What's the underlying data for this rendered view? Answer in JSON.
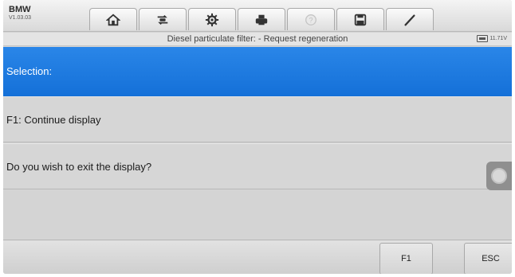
{
  "header": {
    "brand": "BMW",
    "version": "V1.03.03"
  },
  "toolbar": {
    "buttons": [
      {
        "name": "home-icon",
        "label": ""
      },
      {
        "name": "vehicle-swap-icon",
        "label": ""
      },
      {
        "name": "settings-gear-icon",
        "label": ""
      },
      {
        "name": "printer-icon",
        "label": ""
      },
      {
        "name": "help-icon",
        "label": ""
      },
      {
        "name": "save-icon",
        "label": ""
      },
      {
        "name": "edit-pen-icon",
        "label": ""
      }
    ]
  },
  "titlebar": {
    "title": "Diesel particulate filter: - Request regeneration",
    "voltage": "11.71V"
  },
  "content": {
    "selection_label": "Selection:",
    "rows": [
      {
        "label": "F1: Continue display"
      },
      {
        "label": "Do you wish to exit the display?"
      }
    ]
  },
  "footer": {
    "f1_label": "F1",
    "esc_label": "ESC"
  },
  "colors": {
    "selection_bg": "#1f7ee6",
    "row_bg": "#d6d6d6",
    "toolbar_bg": "#e6e6e6"
  }
}
